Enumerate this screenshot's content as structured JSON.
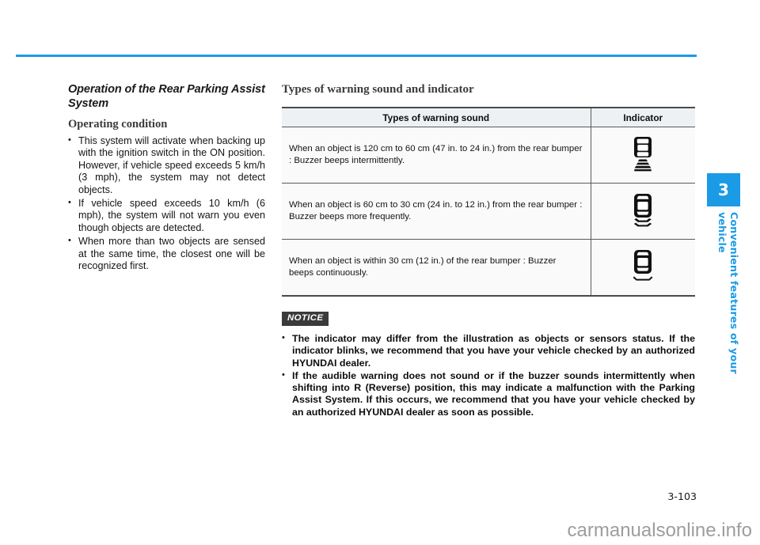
{
  "document": {
    "page_number": "3-103",
    "watermark": "carmanualsonline.info",
    "accent_color": "#1b9ae5"
  },
  "side_tab": {
    "chapter_number": "3",
    "chapter_title": "Convenient features of your vehicle"
  },
  "left_column": {
    "heading": "Operation of the Rear Parking Assist System",
    "subheading": "Operating condition",
    "bullets": [
      "This system will activate when backing up with the ignition switch in the ON position. However, if vehicle speed exceeds 5 km/h (3 mph), the system may not detect objects.",
      "If vehicle speed exceeds 10 km/h (6 mph), the system will not warn you even though objects are detected.",
      "When more than two objects are sensed at the same time, the closest one will be recognized first."
    ]
  },
  "right_column": {
    "heading": "Types of warning sound and indicator",
    "table": {
      "headers": [
        "Types of warning sound",
        "Indicator"
      ],
      "rows": [
        {
          "sound": "When an object is 120 cm to 60 cm (47 in. to 24 in.) from the rear bumper : Buzzer beeps intermittently.",
          "indicator_icon": "car-rear-sensor-far-icon"
        },
        {
          "sound": "When an object is 60 cm to 30 cm (24 in. to 12 in.) from the rear bumper : Buzzer beeps more frequently.",
          "indicator_icon": "car-rear-sensor-mid-icon"
        },
        {
          "sound": "When an object is within 30 cm (12 in.) of the rear bumper : Buzzer beeps continuously.",
          "indicator_icon": "car-rear-sensor-near-icon"
        }
      ]
    },
    "notice": {
      "badge": "NOTICE",
      "items": [
        "The indicator may differ from the illustration as objects or sensors status. If the indicator blinks, we recommend that you have your vehicle checked by an authorized HYUNDAI dealer.",
        "If the audible warning does not sound or if the buzzer sounds intermittently when shifting into R (Reverse) position, this may indicate a malfunction with the Parking Assist System. If this occurs, we recommend that you have your vehicle checked by an authorized HYUNDAI dealer as soon as possible."
      ]
    }
  }
}
